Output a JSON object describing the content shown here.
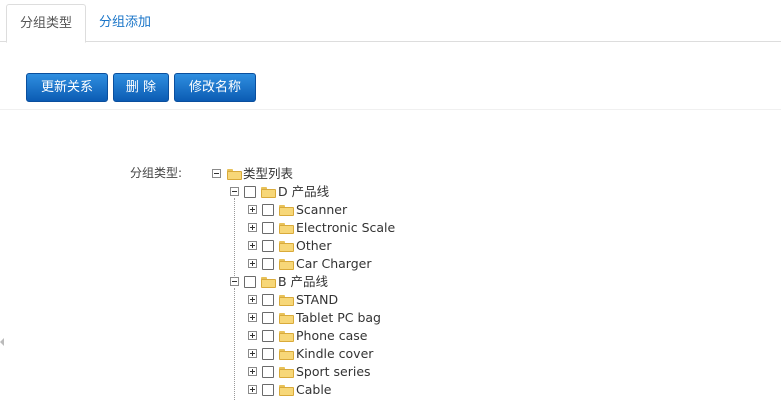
{
  "tabs": [
    {
      "label": "分组类型"
    },
    {
      "label": "分组添加"
    }
  ],
  "toolbar": {
    "update_label": "更新关系",
    "delete_label": "删 除",
    "rename_label": "修改名称"
  },
  "form": {
    "group_type_label": "分组类型:"
  },
  "tree": {
    "root": "类型列表",
    "groups": [
      {
        "label": "D 产品线",
        "items": [
          "Scanner",
          "Electronic Scale",
          "Other",
          "Car Charger"
        ]
      },
      {
        "label": "B 产品线",
        "items": [
          "STAND",
          "Tablet PC bag",
          "Phone case",
          "Kindle cover",
          "Sport series",
          "Cable"
        ]
      }
    ]
  }
}
